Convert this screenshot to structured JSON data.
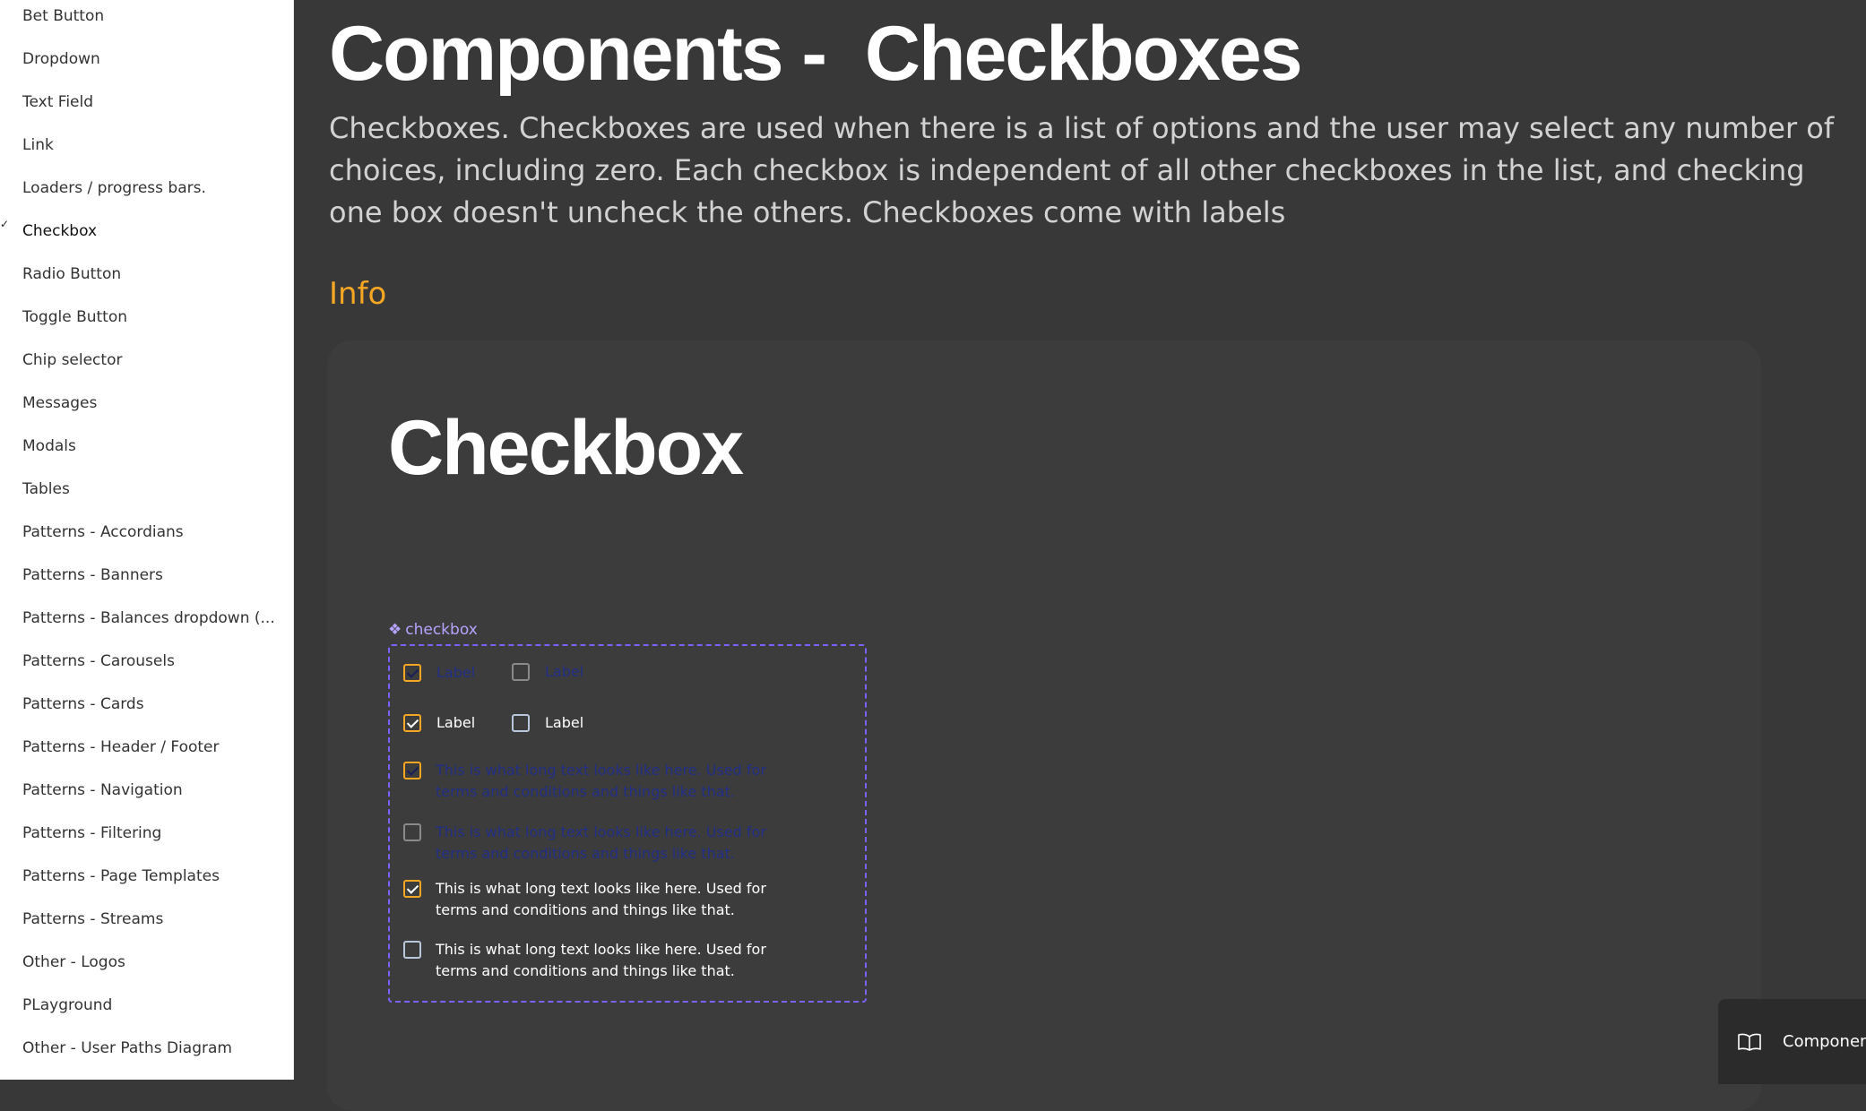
{
  "sidebar": {
    "items": [
      {
        "label": "Bet Button"
      },
      {
        "label": "Dropdown"
      },
      {
        "label": "Text Field"
      },
      {
        "label": "Link"
      },
      {
        "label": "Loaders / progress bars."
      },
      {
        "label": "Checkbox"
      },
      {
        "label": "Radio Button"
      },
      {
        "label": "Toggle Button"
      },
      {
        "label": "Chip selector"
      },
      {
        "label": "Messages"
      },
      {
        "label": "Modals"
      },
      {
        "label": "Tables"
      },
      {
        "label": "Patterns - Accordians"
      },
      {
        "label": "Patterns - Banners"
      },
      {
        "label": "Patterns - Balances dropdown (..."
      },
      {
        "label": "Patterns - Carousels"
      },
      {
        "label": "Patterns - Cards"
      },
      {
        "label": "Patterns - Header / Footer"
      },
      {
        "label": "Patterns - Navigation"
      },
      {
        "label": "Patterns - Filtering"
      },
      {
        "label": "Patterns - Page Templates"
      },
      {
        "label": "Patterns - Streams"
      },
      {
        "label": "Other - Logos"
      },
      {
        "label": "PLayground"
      },
      {
        "label": "Other - User Paths Diagram"
      }
    ]
  },
  "main": {
    "title": "Components -  Checkboxes",
    "description": "Checkboxes. Checkboxes are used when there is a list of options and the user may select any number of choices, including zero. Each checkbox is independent of all other checkboxes in the list, and checking one box doesn't uncheck the others. Checkboxes come with labels",
    "section_heading": "Info",
    "card": {
      "title": "Checkbox",
      "component_tag": "checkbox",
      "rows": [
        {
          "label_a": "Label",
          "label_b": "Label"
        },
        {
          "label_a": "Label",
          "label_b": "Label"
        }
      ],
      "long_text": {
        "line1": "This is what long text looks like here. Used for",
        "line2": "terms and conditions and things like that."
      }
    }
  },
  "float_button": {
    "label": "Component"
  },
  "colors": {
    "accent": "#f5a623",
    "frame": "#7b61ff",
    "background": "#383838"
  }
}
